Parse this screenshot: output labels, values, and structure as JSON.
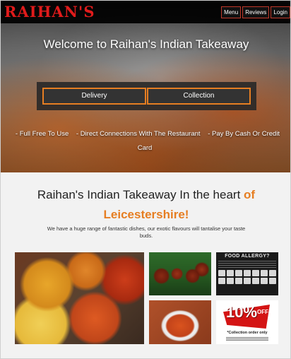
{
  "header": {
    "logo": "RAIHAN'S",
    "nav": [
      {
        "label": "Menu"
      },
      {
        "label": "Reviews"
      },
      {
        "label": "Login"
      }
    ]
  },
  "hero": {
    "welcome": "Welcome to Raihan's Indian Takeaway",
    "order_buttons": {
      "delivery": "Delivery",
      "collection": "Collection"
    },
    "features": [
      "- Full Free To Use",
      "- Direct Connections With The Restaurant",
      "- Pay By Cash Or Credit Card"
    ]
  },
  "about": {
    "title_plain": "Raihan's Indian Takeaway In the heart ",
    "title_highlight": "of Leicestershire!",
    "description": "We have a huge range of fantastic dishes, our exotic flavours will tantalise your taste buds."
  },
  "gallery": {
    "allergy_title": "FOOD ALLERGY?",
    "discount_value": "10%",
    "discount_off": "OFF",
    "discount_note": "*Collection order only"
  },
  "colors": {
    "accent": "#e67e22",
    "logo": "#e01b1b",
    "nav_border": "#c0392b"
  }
}
